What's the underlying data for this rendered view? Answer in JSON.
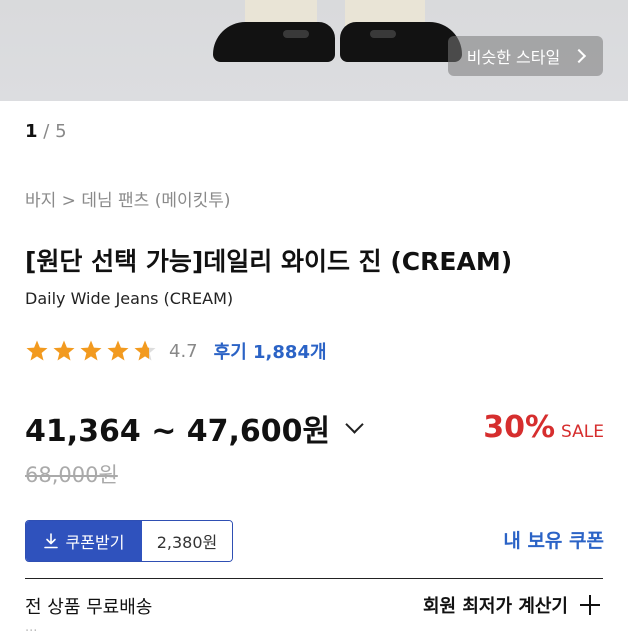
{
  "gallery": {
    "similar_style_label": "비슷한 스타일",
    "page_current": "1",
    "page_separator": "/",
    "page_total": "5"
  },
  "breadcrumb": "바지 > 데님 팬츠 (메이킷투)",
  "product": {
    "title": "[원단 선택 가능]데일리 와이드 진 (CREAM)",
    "subtitle": "Daily Wide Jeans (CREAM)",
    "rating": 4.7,
    "rating_text": "4.7",
    "review_label": "후기 1,884개",
    "price_range": "41,364 ~ 47,600원",
    "discount_pct": "30%",
    "sale_label": "SALE",
    "original_price": "68,000원"
  },
  "coupon": {
    "button_label": "쿠폰받기",
    "amount": "2,380원",
    "my_coupon_label": "내 보유 쿠폰"
  },
  "shipping": {
    "label": "전 상품 무료배송"
  },
  "calculator": {
    "label": "회원 최저가 계산기"
  },
  "cutoff_text": "...",
  "colors": {
    "accent_blue": "#2f52bd",
    "link_blue": "#2b63c6",
    "sale_red": "#d62e2e",
    "star_orange": "#f29a1f"
  }
}
